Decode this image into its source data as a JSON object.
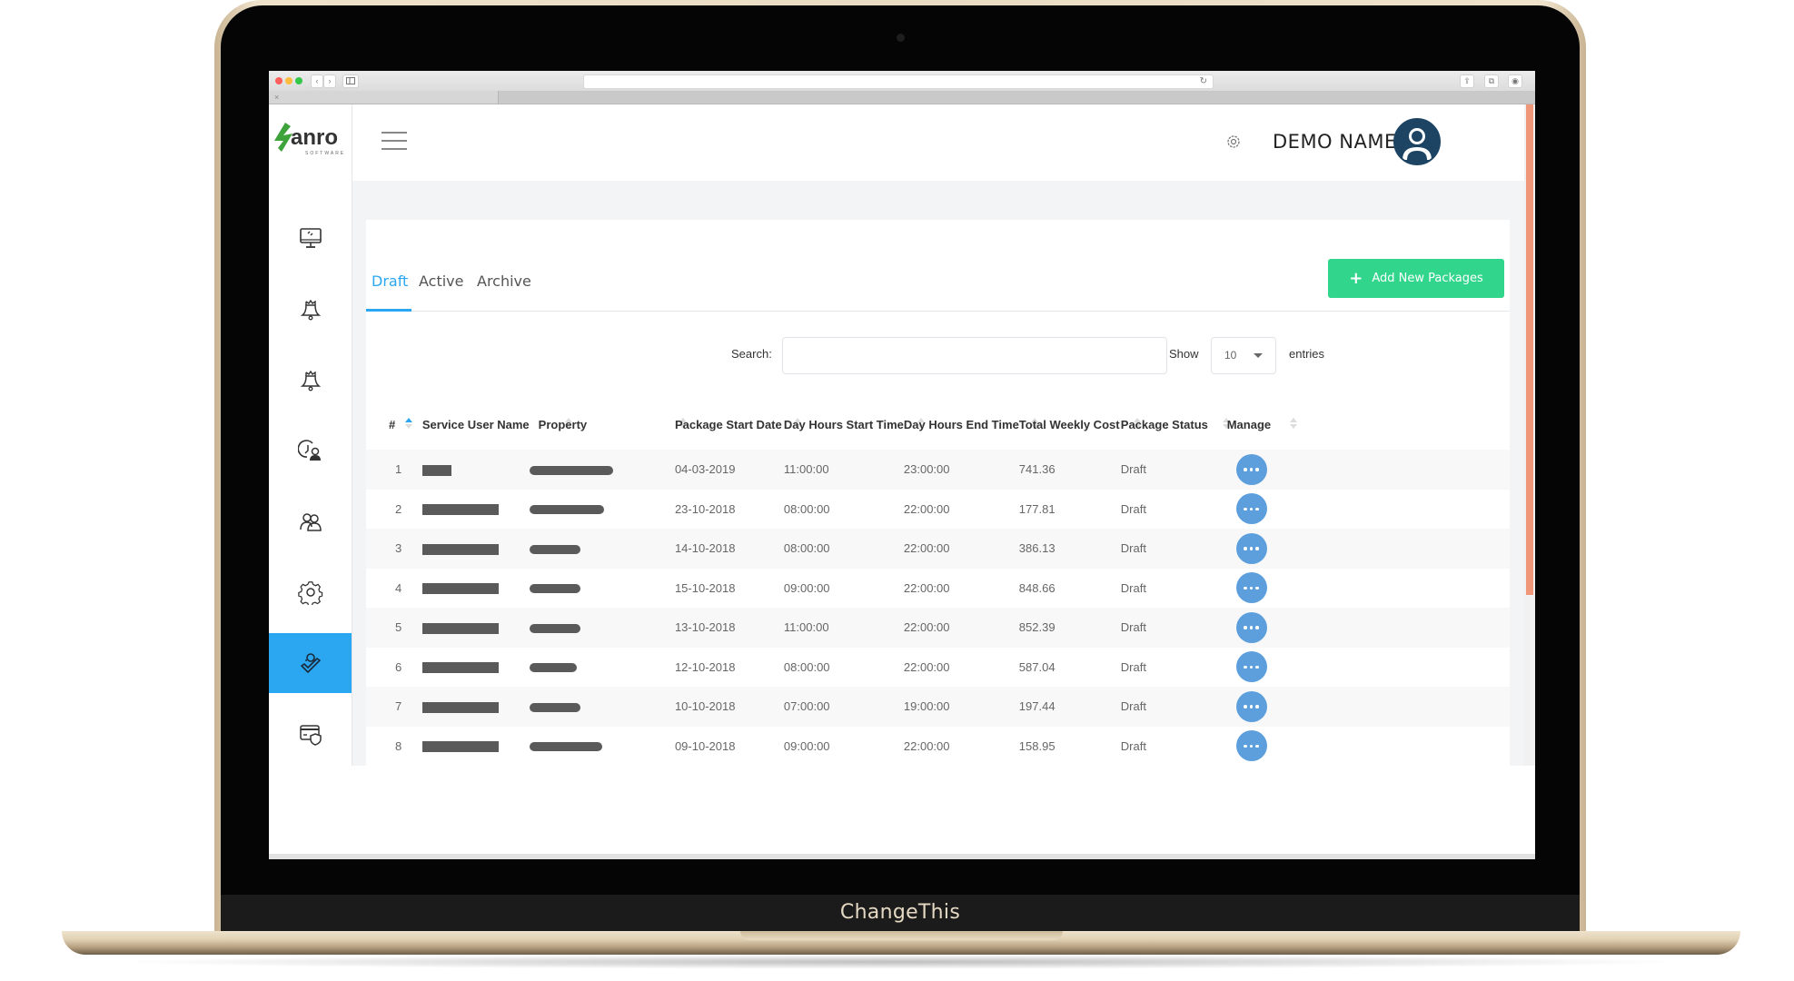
{
  "device": {
    "brand_label": "ChangeThis"
  },
  "browser": {
    "close_tab_glyph": "×",
    "back_glyph": "‹",
    "forward_glyph": "›"
  },
  "app": {
    "logo_text": "anro",
    "logo_subtext": "SOFTWARE",
    "brand_color": "#3da33a",
    "accent_color": "#2aa7f0",
    "header": {
      "user_name": "DEMO NAME"
    },
    "sidebar": {
      "items": [
        {
          "icon": "monitor-icon",
          "active": false
        },
        {
          "icon": "bell-icon",
          "active": false
        },
        {
          "icon": "bell-icon",
          "active": false
        },
        {
          "icon": "clock-user-icon",
          "active": false
        },
        {
          "icon": "users-icon",
          "active": false
        },
        {
          "icon": "gear-icon",
          "active": false
        },
        {
          "icon": "user-check-icon",
          "active": true
        },
        {
          "icon": "card-shield-icon",
          "active": false
        }
      ]
    },
    "tabs": [
      {
        "label": "Draft",
        "active": true
      },
      {
        "label": "Active",
        "active": false
      },
      {
        "label": "Archive",
        "active": false
      }
    ],
    "add_button": {
      "label": "Add New Packages",
      "icon": "plus-icon",
      "color": "#32d58c"
    },
    "filters": {
      "search_label": "Search:",
      "search_value": "",
      "show_label": "Show",
      "page_length": "10",
      "entries_label": "entries"
    },
    "table": {
      "columns": [
        "#",
        "Service User Name",
        "Property",
        "Package Start Date",
        "Day Hours Start Time",
        "Day Hours End Time",
        "Total Weekly Cost",
        "Package Status",
        "Manage"
      ],
      "sorted_column": "#",
      "sort_direction": "asc",
      "rows": [
        {
          "num": "1",
          "user_name": "[redacted]",
          "property": "[redacted]",
          "start_date": "04-03-2019",
          "start_time": "11:00:00",
          "end_time": "23:00:00",
          "cost": "741.36",
          "status": "Draft"
        },
        {
          "num": "2",
          "user_name": "[redacted]",
          "property": "[redacted]",
          "start_date": "23-10-2018",
          "start_time": "08:00:00",
          "end_time": "22:00:00",
          "cost": "177.81",
          "status": "Draft"
        },
        {
          "num": "3",
          "user_name": "[redacted]",
          "property": "[redacted]",
          "start_date": "14-10-2018",
          "start_time": "08:00:00",
          "end_time": "22:00:00",
          "cost": "386.13",
          "status": "Draft"
        },
        {
          "num": "4",
          "user_name": "[redacted]",
          "property": "[redacted]",
          "start_date": "15-10-2018",
          "start_time": "09:00:00",
          "end_time": "22:00:00",
          "cost": "848.66",
          "status": "Draft"
        },
        {
          "num": "5",
          "user_name": "[redacted]",
          "property": "[redacted]",
          "start_date": "13-10-2018",
          "start_time": "11:00:00",
          "end_time": "22:00:00",
          "cost": "852.39",
          "status": "Draft"
        },
        {
          "num": "6",
          "user_name": "[redacted]",
          "property": "[redacted]",
          "start_date": "12-10-2018",
          "start_time": "08:00:00",
          "end_time": "22:00:00",
          "cost": "587.04",
          "status": "Draft"
        },
        {
          "num": "7",
          "user_name": "[redacted]",
          "property": "[redacted]",
          "start_date": "10-10-2018",
          "start_time": "07:00:00",
          "end_time": "19:00:00",
          "cost": "197.44",
          "status": "Draft"
        },
        {
          "num": "8",
          "user_name": "[redacted]",
          "property": "[redacted]",
          "start_date": "09-10-2018",
          "start_time": "09:00:00",
          "end_time": "22:00:00",
          "cost": "158.95",
          "status": "Draft"
        }
      ]
    }
  }
}
